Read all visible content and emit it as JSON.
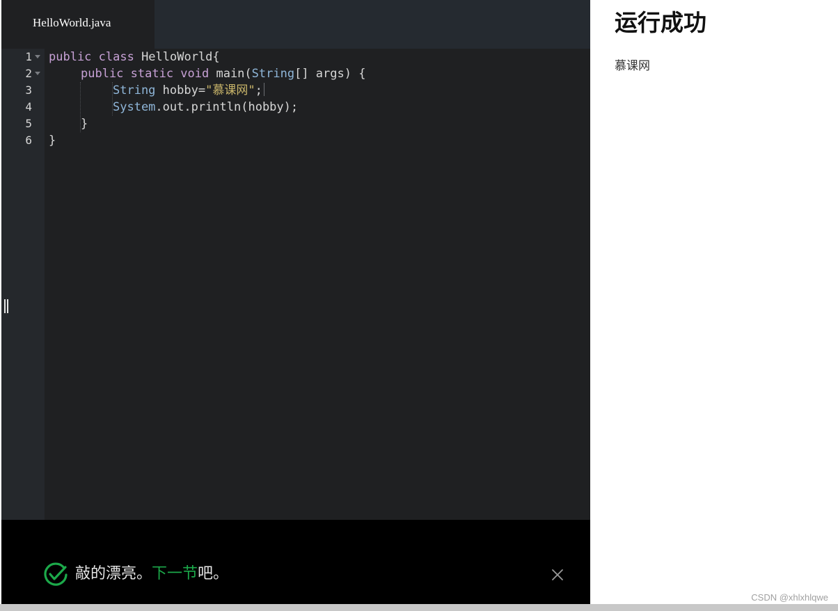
{
  "editor": {
    "tab_label": "HelloWorld.java",
    "line_numbers": [
      "1",
      "2",
      "3",
      "4",
      "5",
      "6"
    ],
    "code": {
      "line1": {
        "kw": "public class ",
        "name": "HelloWorld{"
      },
      "line2": {
        "kw": "public static void ",
        "name": "main(",
        "type": "String",
        "rest": "[] args) {"
      },
      "line3": {
        "type": "String",
        "mid": " hobby=",
        "str": "\"慕课网\"",
        "end": ";"
      },
      "line4": {
        "type": "System",
        "rest": ".out.println(hobby);"
      },
      "line5": {
        "text": "}"
      },
      "line6": {
        "text": "}"
      }
    }
  },
  "success_bar": {
    "message_prefix": "敲的漂亮。",
    "next_link": "下一节",
    "message_suffix": "吧。",
    "accent_color": "#1ca94a"
  },
  "result": {
    "title": "运行成功",
    "output": "慕课网"
  },
  "watermark": "CSDN @xhlxhlqwe"
}
